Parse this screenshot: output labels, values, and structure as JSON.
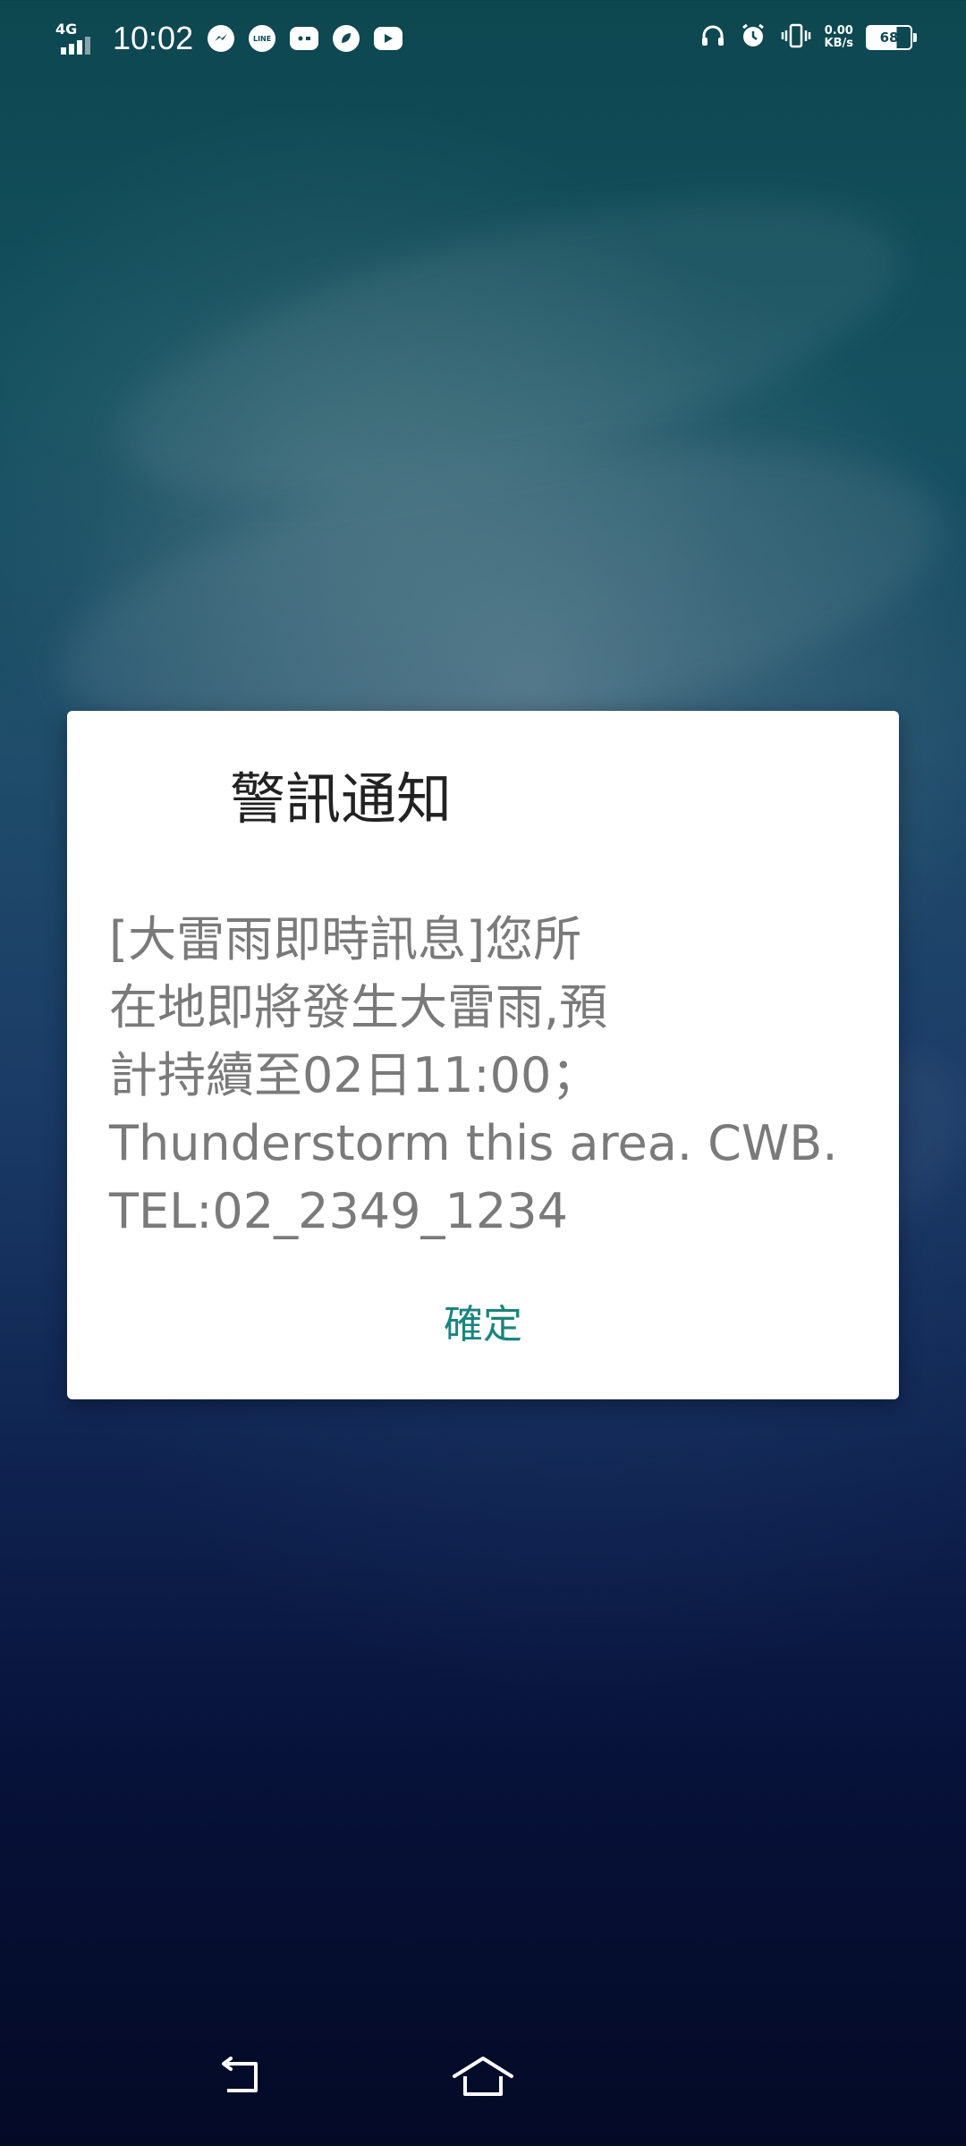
{
  "status_bar": {
    "network_type": "4G",
    "time": "10:02",
    "notification_icons": [
      "messenger-icon",
      "line-icon",
      "game-icon",
      "leaf-icon",
      "youtube-icon"
    ],
    "line_label": "LINE",
    "net_speed_value": "0.00",
    "net_speed_unit": "KB/s",
    "battery_level": "68",
    "right_icons": [
      "headphones-icon",
      "alarm-icon",
      "vibrate-icon"
    ]
  },
  "dialog": {
    "title": "警訊通知",
    "message": "[大雷雨即時訊息]您所\n在地即將發生大雷雨,預\n計持續至02日11:00；\nThunderstorm this area. CWB.\nTEL:02_2349_1234",
    "confirm_label": "確定"
  },
  "nav_bar": {
    "buttons": [
      "back-icon",
      "home-icon"
    ]
  },
  "colors": {
    "accent": "#1a857e",
    "dialog_bg": "#ffffff",
    "title_text": "#222222",
    "message_text": "#7a7a7a"
  }
}
